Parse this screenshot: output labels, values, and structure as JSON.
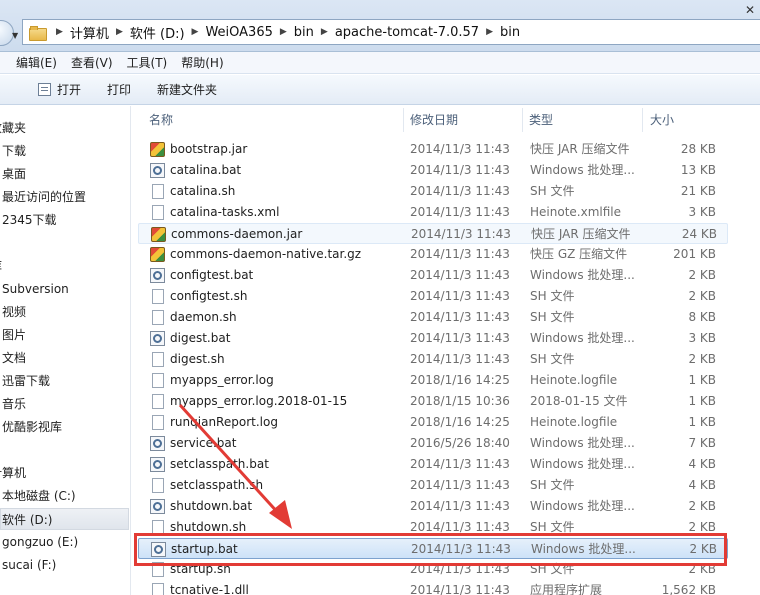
{
  "address_bar": {
    "crumbs": [
      "计算机",
      "软件 (D:)",
      "WeiOA365",
      "bin",
      "apache-tomcat-7.0.57",
      "bin"
    ],
    "close_glyph": "✕"
  },
  "menu": [
    "编辑(E)",
    "查看(V)",
    "工具(T)",
    "帮助(H)"
  ],
  "toolbar": {
    "open_label": "打开",
    "print_label": "打印",
    "new_folder_label": "新建文件夹"
  },
  "sidebar": {
    "items": [
      "收藏夹",
      "下载",
      "桌面",
      "最近访问的位置",
      "2345下载",
      "库",
      "Subversion",
      "视频",
      "图片",
      "文档",
      "迅雷下载",
      "音乐",
      "优酷影视库",
      "计算机",
      "本地磁盘 (C:)",
      "软件 (D:)",
      "gongzuo (E:)",
      "sucai (F:)"
    ],
    "selected": "软件 (D:)"
  },
  "columns": {
    "name": "名称",
    "date": "修改日期",
    "type": "类型",
    "size": "大小"
  },
  "files": [
    {
      "name": "bootstrap.jar",
      "date": "2014/11/3 11:43",
      "type": "快压 JAR 压缩文件",
      "size": "28 KB",
      "icon": "jar-icon"
    },
    {
      "name": "catalina.bat",
      "date": "2014/11/3 11:43",
      "type": "Windows 批处理...",
      "size": "13 KB",
      "icon": "bat-icon"
    },
    {
      "name": "catalina.sh",
      "date": "2014/11/3 11:43",
      "type": "SH 文件",
      "size": "21 KB",
      "icon": "doc-icon"
    },
    {
      "name": "catalina-tasks.xml",
      "date": "2014/11/3 11:43",
      "type": "Heinote.xmlfile",
      "size": "3 KB",
      "icon": "doc-icon"
    },
    {
      "name": "commons-daemon.jar",
      "date": "2014/11/3 11:43",
      "type": "快压 JAR 压缩文件",
      "size": "24 KB",
      "icon": "jar-icon"
    },
    {
      "name": "commons-daemon-native.tar.gz",
      "date": "2014/11/3 11:43",
      "type": "快压 GZ 压缩文件",
      "size": "201 KB",
      "icon": "jar-icon"
    },
    {
      "name": "configtest.bat",
      "date": "2014/11/3 11:43",
      "type": "Windows 批处理...",
      "size": "2 KB",
      "icon": "bat-icon"
    },
    {
      "name": "configtest.sh",
      "date": "2014/11/3 11:43",
      "type": "SH 文件",
      "size": "2 KB",
      "icon": "doc-icon"
    },
    {
      "name": "daemon.sh",
      "date": "2014/11/3 11:43",
      "type": "SH 文件",
      "size": "8 KB",
      "icon": "doc-icon"
    },
    {
      "name": "digest.bat",
      "date": "2014/11/3 11:43",
      "type": "Windows 批处理...",
      "size": "3 KB",
      "icon": "bat-icon"
    },
    {
      "name": "digest.sh",
      "date": "2014/11/3 11:43",
      "type": "SH 文件",
      "size": "2 KB",
      "icon": "doc-icon"
    },
    {
      "name": "myapps_error.log",
      "date": "2018/1/16 14:25",
      "type": "Heinote.logfile",
      "size": "1 KB",
      "icon": "doc-icon"
    },
    {
      "name": "myapps_error.log.2018-01-15",
      "date": "2018/1/15 10:36",
      "type": "2018-01-15 文件",
      "size": "1 KB",
      "icon": "doc-icon"
    },
    {
      "name": "runqianReport.log",
      "date": "2018/1/16 14:25",
      "type": "Heinote.logfile",
      "size": "1 KB",
      "icon": "doc-icon"
    },
    {
      "name": "service.bat",
      "date": "2016/5/26 18:40",
      "type": "Windows 批处理...",
      "size": "7 KB",
      "icon": "bat-icon"
    },
    {
      "name": "setclasspath.bat",
      "date": "2014/11/3 11:43",
      "type": "Windows 批处理...",
      "size": "4 KB",
      "icon": "bat-icon"
    },
    {
      "name": "setclasspath.sh",
      "date": "2014/11/3 11:43",
      "type": "SH 文件",
      "size": "4 KB",
      "icon": "doc-icon"
    },
    {
      "name": "shutdown.bat",
      "date": "2014/11/3 11:43",
      "type": "Windows 批处理...",
      "size": "2 KB",
      "icon": "bat-icon"
    },
    {
      "name": "shutdown.sh",
      "date": "2014/11/3 11:43",
      "type": "SH 文件",
      "size": "2 KB",
      "icon": "doc-icon"
    },
    {
      "name": "startup.bat",
      "date": "2014/11/3 11:43",
      "type": "Windows 批处理...",
      "size": "2 KB",
      "icon": "bat-icon"
    },
    {
      "name": "startup.sh",
      "date": "2014/11/3 11:43",
      "type": "SH 文件",
      "size": "2 KB",
      "icon": "doc-icon"
    },
    {
      "name": "tcnative-1.dll",
      "date": "2014/11/3 11:43",
      "type": "应用程序扩展",
      "size": "1,562 KB",
      "icon": "doc-icon"
    }
  ],
  "hover_file": "commons-daemon.jar",
  "selected_file": "startup.bat",
  "annotation_color": "#e23b35"
}
